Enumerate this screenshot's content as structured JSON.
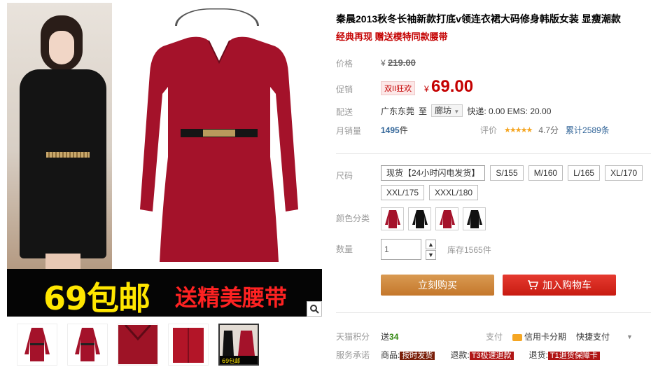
{
  "gallery": {
    "promo_price_text": "69包邮",
    "promo_gift_text": "送精美腰带",
    "thumbnails": [
      "thumb-1",
      "thumb-2",
      "thumb-3",
      "thumb-4",
      "thumb-5"
    ],
    "active_thumb_caption": "69包邮"
  },
  "product": {
    "title": "秦晨2013秋冬长袖新款打底v领连衣裙大码修身韩版女装 显瘦潮款",
    "subtitle": "经典再现 赠送模特同款腰带"
  },
  "price": {
    "label": "价格",
    "currency": "¥",
    "original": "219.00",
    "promo_label": "促销",
    "promo_tag": "双II狂欢",
    "current": "69.00"
  },
  "shipping": {
    "label": "配送",
    "from": "广东东莞",
    "to_word": "至",
    "destination": "廊坊",
    "fees": "快递: 0.00 EMS: 20.00"
  },
  "sales": {
    "label": "月销量",
    "count": "1495",
    "unit": "件",
    "rating_label": "评价",
    "stars": "★★★★★",
    "score": "4.7分",
    "reviews": "累计2589条"
  },
  "sizes": {
    "label": "尺码",
    "options": [
      "现货【24小时闪电发货】",
      "S/155",
      "M/160",
      "L/165",
      "XL/170",
      "XXL/175",
      "XXXL/180"
    ]
  },
  "colors": {
    "label": "颜色分类",
    "options": [
      "red",
      "black",
      "red",
      "black"
    ]
  },
  "quantity": {
    "label": "数量",
    "value": "1",
    "stock": "库存1565件"
  },
  "actions": {
    "buy_now": "立刻购买",
    "add_cart": "加入购物车"
  },
  "points": {
    "label": "天猫积分",
    "prefix": "送",
    "value": "34",
    "pay_label": "支付",
    "credit": "信用卡分期",
    "quick_pay": "快捷支付"
  },
  "promise": {
    "label": "服务承诺",
    "items": [
      {
        "prefix": "商品:",
        "tag": "按时发货"
      },
      {
        "prefix": "退款:",
        "tag": "T3极速退款"
      },
      {
        "prefix": "退货:",
        "tag": "T1退货保障卡"
      }
    ]
  },
  "theme": {
    "accent": "#c40000",
    "buy_color": "#c4772b",
    "cart_color": "#c81b12"
  }
}
